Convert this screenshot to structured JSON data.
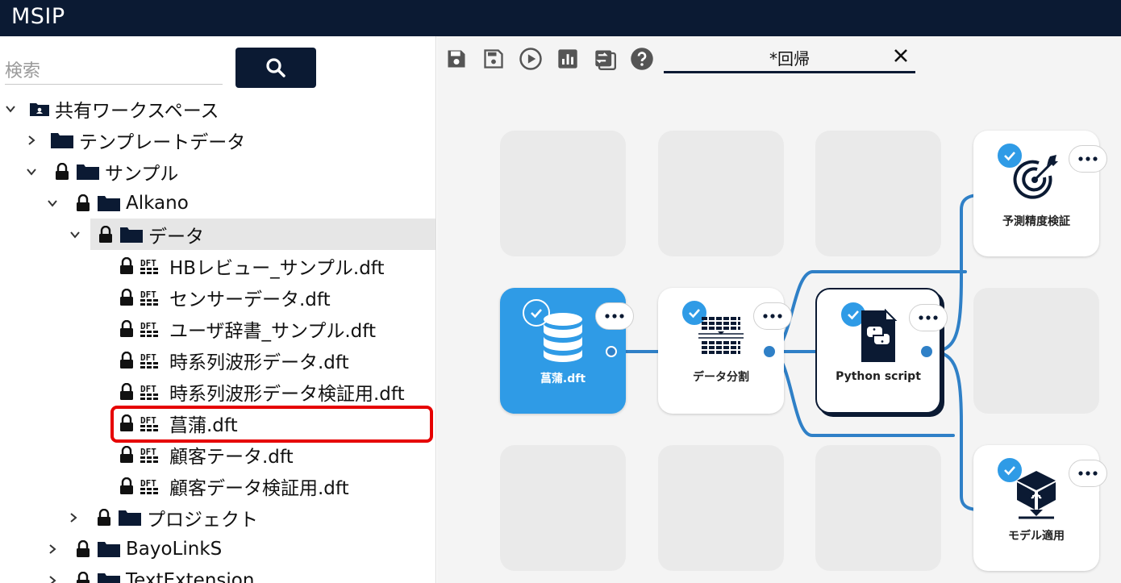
{
  "app": {
    "title": "MSIP"
  },
  "search": {
    "placeholder": "検索"
  },
  "tree": {
    "shared_workspace": "共有ワークスペース",
    "template_data": "テンプレートデータ",
    "sample": "サンプル",
    "alkano": "Alkano",
    "data": "データ",
    "files": [
      "HBレビュー_サンプル.dft",
      "センサーデータ.dft",
      "ユーザ辞書_サンプル.dft",
      "時系列波形データ.dft",
      "時系列波形データ検証用.dft",
      "菖蒲.dft",
      "顧客テータ.dft",
      "顧客データ検証用.dft"
    ],
    "project": "プロジェクト",
    "bayolinks": "BayoLinkS",
    "textextension": "TextExtension"
  },
  "tab": {
    "label": "*回帰"
  },
  "nodes": {
    "input": "菖蒲.dft",
    "split": "データ分割",
    "python": "Python script",
    "evaluate": "予測精度検証",
    "apply": "モデル適用"
  },
  "colors": {
    "navy": "#0b1a33",
    "accent_blue": "#2f9be6",
    "highlight_red": "#e60000",
    "edge_blue": "#2f80c7"
  }
}
